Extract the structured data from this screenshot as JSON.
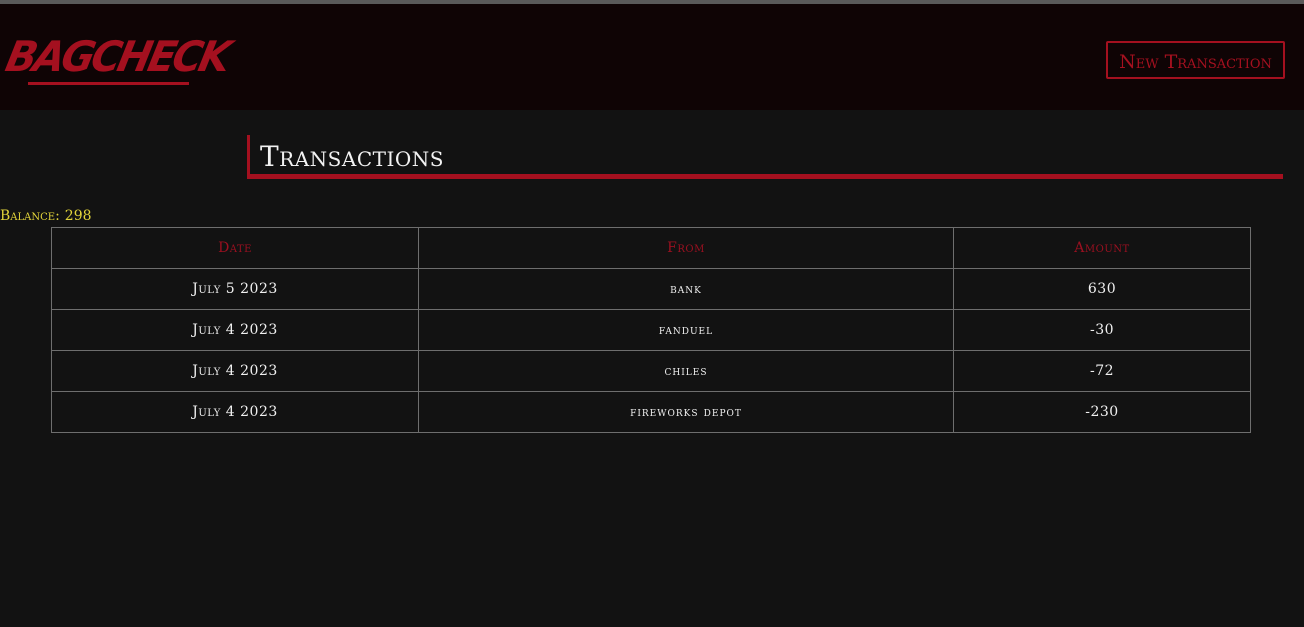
{
  "header": {
    "logo_text": "BAGCHECK",
    "new_transaction_label": "New Transaction"
  },
  "page": {
    "title": "Transactions"
  },
  "balance": {
    "label": "Balance:",
    "value": "298"
  },
  "table": {
    "columns": [
      "Date",
      "From",
      "Amount"
    ],
    "rows": [
      {
        "date": "July 5 2023",
        "from": "bank",
        "amount": "630"
      },
      {
        "date": "July 4 2023",
        "from": "fanduel",
        "amount": "-30"
      },
      {
        "date": "July 4 2023",
        "from": "chiles",
        "amount": "-72"
      },
      {
        "date": "July 4 2023",
        "from": "fireworks depot",
        "amount": "-230"
      }
    ]
  },
  "colors": {
    "accent": "#a4101f",
    "balance": "#e2d43a",
    "background": "#121212",
    "header_background": "#0f0405"
  }
}
